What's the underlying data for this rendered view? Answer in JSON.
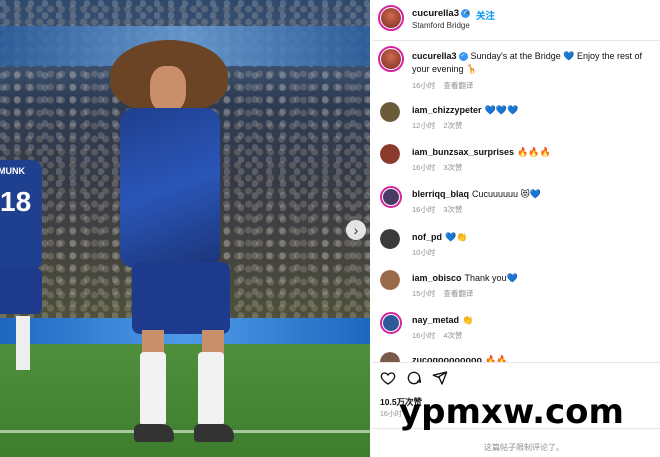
{
  "post": {
    "username": "cucurella3",
    "follow_label": "关注",
    "dot": "•",
    "location": "Stamford Bridge",
    "caption": "Sunday's at the Bridge 💙 Enjoy the rest of your evening 🦒",
    "caption_time": "16小时",
    "caption_translate": "查看翻译",
    "likes": "10.5万次赞",
    "post_time": "16小时",
    "comments_limited": "这篇帖子限制评论了。"
  },
  "photo": {
    "player_left_name": "MUNK",
    "player_left_number": "18",
    "next_arrow": "›"
  },
  "comments": [
    {
      "user": "iam_chizzypeter",
      "text": "💙💙💙",
      "time": "12小时",
      "likes": "2次赞"
    },
    {
      "user": "iam_bunzsax_surprises",
      "text": "🔥🔥🔥",
      "time": "16小时",
      "likes": "3次赞"
    },
    {
      "user": "blerriqq_blaq",
      "text": "Cucuuuuuu 😻💙",
      "time": "16小时",
      "likes": "3次赞"
    },
    {
      "user": "nof_pd",
      "text": "💙👏",
      "time": "10小时",
      "likes": ""
    },
    {
      "user": "iam_obisco",
      "text": "Thank you💙",
      "time": "15小时",
      "likes": "查看翻译"
    },
    {
      "user": "nay_metad",
      "text": "👏",
      "time": "16小时",
      "likes": "4次赞"
    },
    {
      "user": "zucogoooooooo",
      "text": "🔥🔥",
      "time": "",
      "likes": ""
    }
  ],
  "watermark": "ypmxw.com",
  "icons": {
    "like": "heart-icon",
    "comment": "comment-icon",
    "share": "share-icon",
    "verified": "verified-badge-icon"
  },
  "colors": {
    "follow": "#0095f6",
    "verified": "#3897f0",
    "meta": "#8e8e8e",
    "story_ring": "#d6249f"
  }
}
